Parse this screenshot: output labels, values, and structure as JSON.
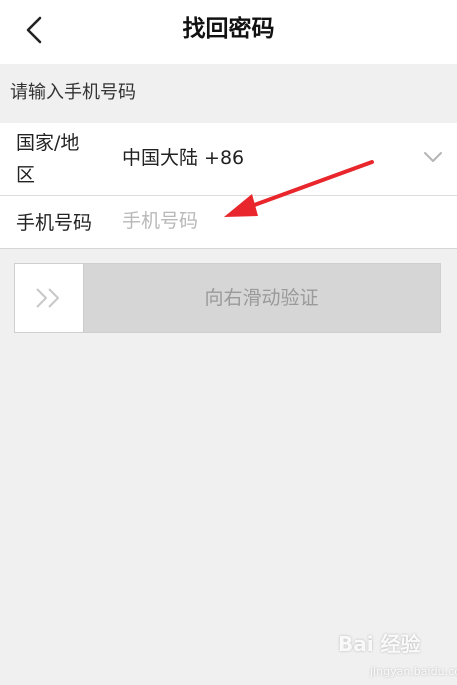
{
  "header": {
    "title": "找回密码",
    "back_icon": "chevron-left-icon"
  },
  "section": {
    "hint": "请输入手机号码"
  },
  "form": {
    "country_label": "国家/地区",
    "country_value": "中国大陆 +86",
    "country_dropdown_icon": "chevron-down-icon",
    "phone_label": "手机号码",
    "phone_value": "",
    "phone_placeholder": "手机号码"
  },
  "slider": {
    "label": "向右滑动验证",
    "handle_icon": "double-chevron-right-icon"
  },
  "annotation": {
    "arrow_color": "#e8262b"
  },
  "watermark": {
    "text": "Bai 经验",
    "sub": "jingyan.baidu.com"
  }
}
